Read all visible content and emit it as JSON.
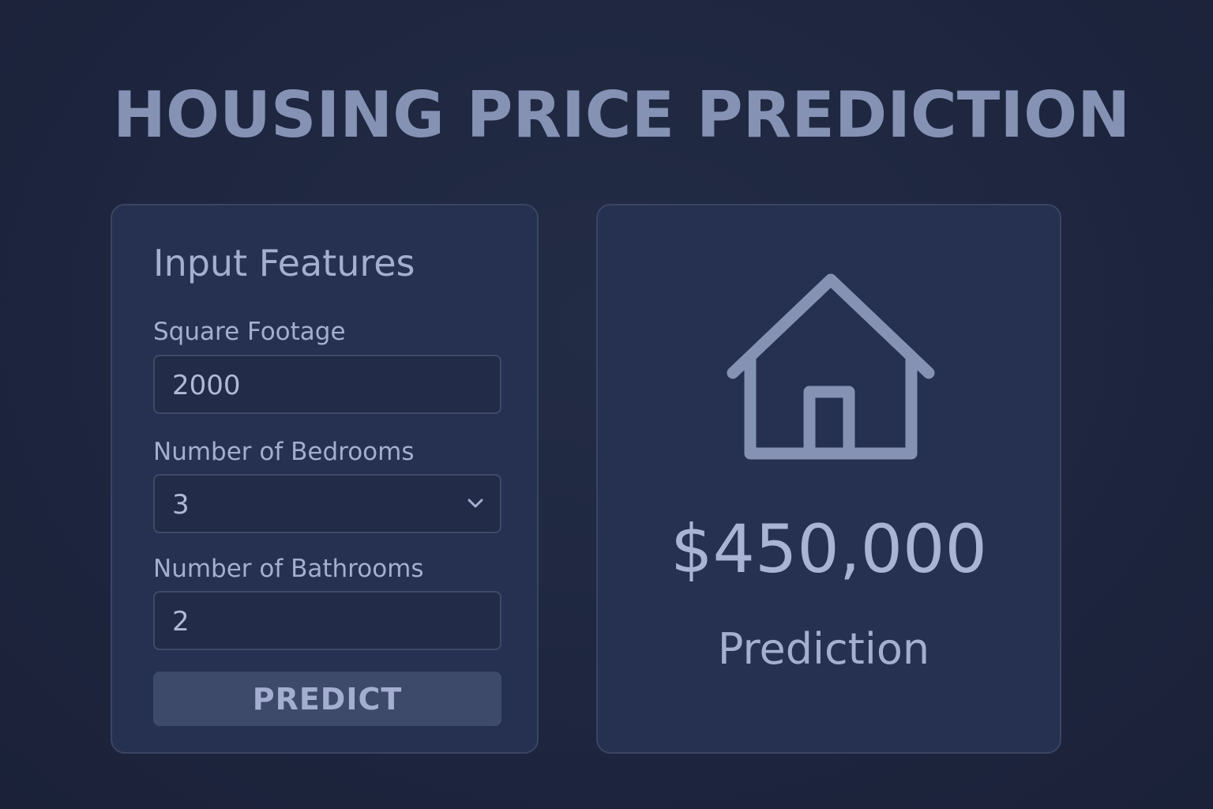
{
  "header": {
    "title": "HOUSING PRICE PREDICTION"
  },
  "input_panel": {
    "heading": "Input Features",
    "fields": [
      {
        "label": "Square Footage",
        "value": "2000",
        "type": "text"
      },
      {
        "label": "Number of Bedrooms",
        "value": "3",
        "type": "select"
      },
      {
        "label": "Number of Bathrooms",
        "value": "2",
        "type": "text"
      }
    ],
    "button_label": "PREDICT"
  },
  "result_panel": {
    "icon": "house-icon",
    "price": "$450,000",
    "label": "Prediction"
  },
  "colors": {
    "background": "#1e2640",
    "panel": "#263050",
    "text": "#a3aed0",
    "title": "#8592b4",
    "button": "#3e4a6a"
  }
}
